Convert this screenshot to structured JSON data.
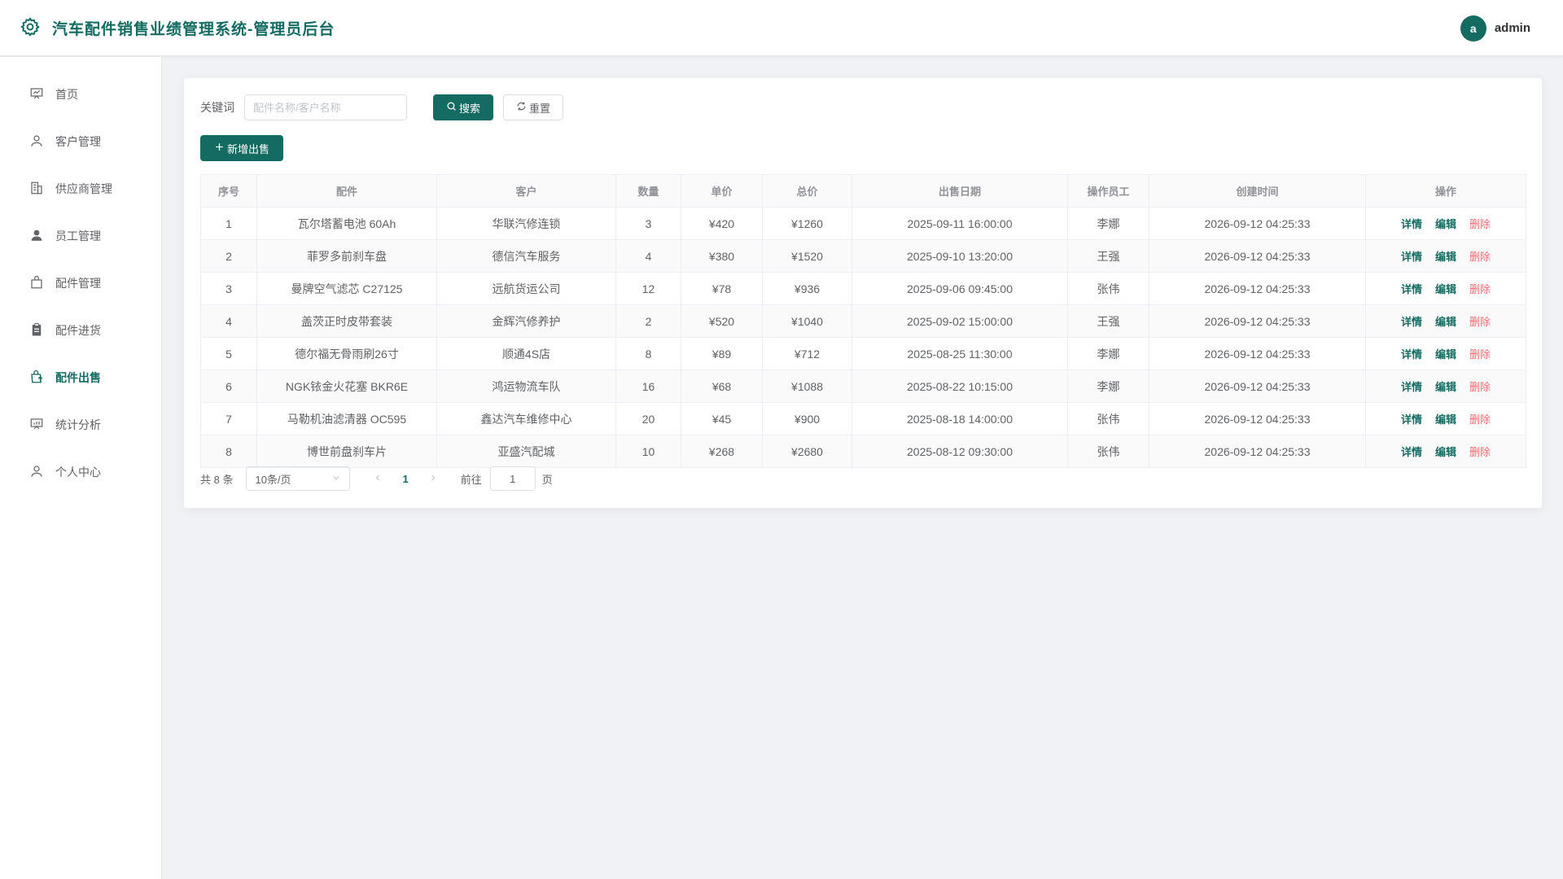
{
  "header": {
    "title": "汽车配件销售业绩管理系统-管理员后台",
    "avatar_initial": "a",
    "username": "admin"
  },
  "sidebar": {
    "items": [
      {
        "label": "首页",
        "icon": "presentation-icon"
      },
      {
        "label": "客户管理",
        "icon": "user-icon"
      },
      {
        "label": "供应商管理",
        "icon": "building-icon"
      },
      {
        "label": "员工管理",
        "icon": "user-filled-icon"
      },
      {
        "label": "配件管理",
        "icon": "bag-icon"
      },
      {
        "label": "配件进货",
        "icon": "clipboard-icon"
      },
      {
        "label": "配件出售",
        "icon": "sell-icon",
        "active": true
      },
      {
        "label": "统计分析",
        "icon": "chart-board-icon"
      },
      {
        "label": "个人中心",
        "icon": "user-icon"
      }
    ]
  },
  "search": {
    "label": "关键词",
    "placeholder": "配件名称/客户名称",
    "search_label": "搜索",
    "reset_label": "重置"
  },
  "actions": {
    "add_label": "新增出售"
  },
  "table": {
    "columns": [
      "序号",
      "配件",
      "客户",
      "数量",
      "单价",
      "总价",
      "出售日期",
      "操作员工",
      "创建时间",
      "操作"
    ],
    "rows": [
      [
        "1",
        "瓦尔塔蓄电池 60Ah",
        "华联汽修连锁",
        "3",
        "¥420",
        "¥1260",
        "2025-09-11 16:00:00",
        "李娜",
        "2026-09-12 04:25:33"
      ],
      [
        "2",
        "菲罗多前刹车盘",
        "德信汽车服务",
        "4",
        "¥380",
        "¥1520",
        "2025-09-10 13:20:00",
        "王强",
        "2026-09-12 04:25:33"
      ],
      [
        "3",
        "曼牌空气滤芯 C27125",
        "远航货运公司",
        "12",
        "¥78",
        "¥936",
        "2025-09-06 09:45:00",
        "张伟",
        "2026-09-12 04:25:33"
      ],
      [
        "4",
        "盖茨正时皮带套装",
        "金辉汽修养护",
        "2",
        "¥520",
        "¥1040",
        "2025-09-02 15:00:00",
        "王强",
        "2026-09-12 04:25:33"
      ],
      [
        "5",
        "德尔福无骨雨刷26寸",
        "顺通4S店",
        "8",
        "¥89",
        "¥712",
        "2025-08-25 11:30:00",
        "李娜",
        "2026-09-12 04:25:33"
      ],
      [
        "6",
        "NGK铱金火花塞 BKR6E",
        "鸿运物流车队",
        "16",
        "¥68",
        "¥1088",
        "2025-08-22 10:15:00",
        "李娜",
        "2026-09-12 04:25:33"
      ],
      [
        "7",
        "马勒机油滤清器 OC595",
        "鑫达汽车维修中心",
        "20",
        "¥45",
        "¥900",
        "2025-08-18 14:00:00",
        "张伟",
        "2026-09-12 04:25:33"
      ],
      [
        "8",
        "博世前盘刹车片",
        "亚盛汽配城",
        "10",
        "¥268",
        "¥2680",
        "2025-08-12 09:30:00",
        "张伟",
        "2026-09-12 04:25:33"
      ]
    ],
    "op_labels": {
      "detail": "详情",
      "edit": "编辑",
      "delete": "删除"
    }
  },
  "pagination": {
    "total_text": "共 8 条",
    "page_size": "10条/页",
    "current_page": "1",
    "goto_label": "前往",
    "goto_value": "1",
    "page_unit": "页"
  },
  "colors": {
    "primary": "#136b62",
    "danger": "#f56c6c"
  }
}
